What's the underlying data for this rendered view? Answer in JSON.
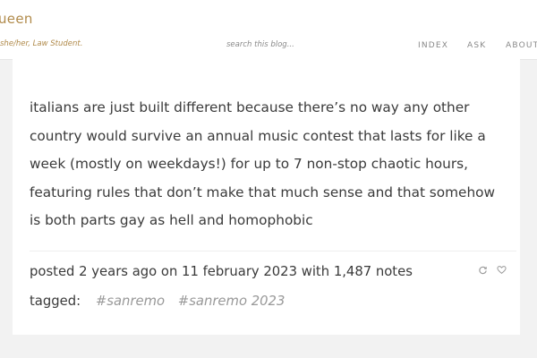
{
  "header": {
    "title": "ueen",
    "description": "she/her, Law Student.",
    "search_placeholder": "search this blog...",
    "nav": [
      "INDEX",
      "ASK",
      "ABOUT"
    ]
  },
  "post": {
    "body": "italians are just built different because there’s no way any other country would survive an annual music contest that lasts for like a week (mostly on weekdays!) for up to 7 non-stop chaotic hours, featuring rules that don’t make that much sense and that somehow is both parts gay as hell and homophobic",
    "meta": "posted 2 years ago on 11 february 2023 with 1,487 notes",
    "tagged_label": "tagged:",
    "tags": [
      "#sanremo",
      "#sanremo 2023"
    ]
  },
  "icons": {
    "reblog": "reblog-icon",
    "like": "heart-icon"
  },
  "colors": {
    "accent": "#b08a4a",
    "background": "#f2f2f2",
    "card": "#ffffff"
  }
}
